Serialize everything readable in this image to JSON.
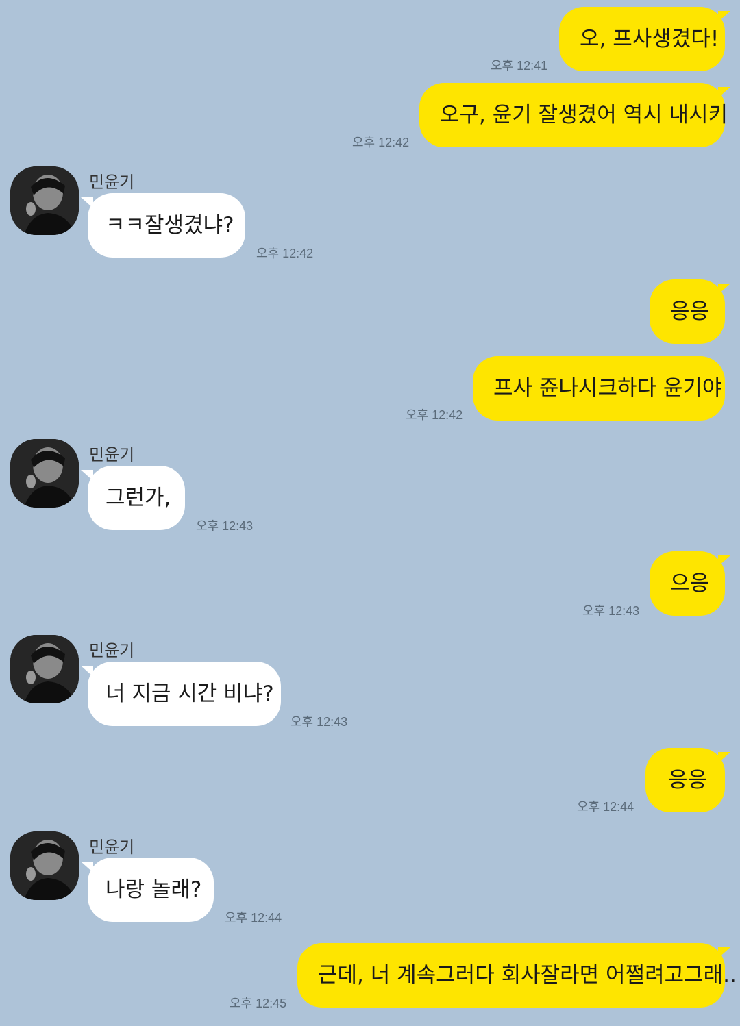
{
  "contact": {
    "name": "민윤기",
    "avatar_icon": "profile-photo-avatar-icon"
  },
  "colors": {
    "background": "#aec3d8",
    "my_bubble": "#fee500",
    "their_bubble": "#ffffff"
  },
  "messages": [
    {
      "from": "me",
      "text": "오, 프사생겼다!",
      "time": "오후 12:41"
    },
    {
      "from": "me",
      "text": "오구, 윤기 잘생겼어 역시 내시키",
      "time": "오후 12:42"
    },
    {
      "from": "them",
      "sender": "민윤기",
      "text": "ㅋㅋ잘생겼냐?",
      "time": "오후 12:42"
    },
    {
      "from": "me",
      "text": "응응",
      "time": ""
    },
    {
      "from": "me",
      "text": "프사 쥰나시크하다 윤기야",
      "time": "오후 12:42"
    },
    {
      "from": "them",
      "sender": "민윤기",
      "text": "그런가,",
      "time": "오후 12:43"
    },
    {
      "from": "me",
      "text": "으응",
      "time": "오후 12:43"
    },
    {
      "from": "them",
      "sender": "민윤기",
      "text": "너 지금 시간 비냐?",
      "time": "오후 12:43"
    },
    {
      "from": "me",
      "text": "응응",
      "time": "오후 12:44"
    },
    {
      "from": "them",
      "sender": "민윤기",
      "text": "나랑 놀래?",
      "time": "오후 12:44"
    },
    {
      "from": "me",
      "text": "근데, 너 계속그러다 회사잘라면 어쩔려고그래..",
      "time": "오후 12:45"
    }
  ]
}
